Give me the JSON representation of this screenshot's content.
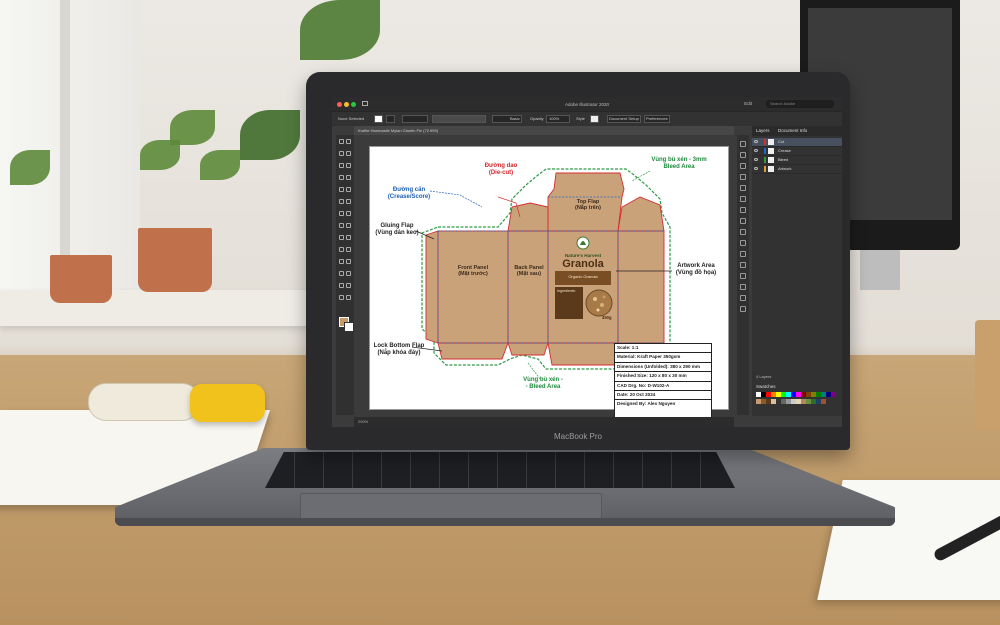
{
  "device": {
    "brand_label": "MacBook Pro"
  },
  "app": {
    "title": "Adobe Illustrator 2020",
    "menu_right": "Edit",
    "search_placeholder": "Search Adobe"
  },
  "control_bar": {
    "selection_label": "None Selected",
    "stroke_style": "Basic",
    "opacity_label": "Opacity",
    "opacity_value": "100%",
    "style_label": "Style",
    "doc_setup_label": "Document Setup",
    "preferences_label": "Preferences"
  },
  "document": {
    "tab_label": "Kraftie Hardcastle Mylan Glantin Ftv (72.959)",
    "zoom": "200%"
  },
  "layers_panel": {
    "tabs": [
      "Layers",
      "Document Info"
    ],
    "layers": [
      {
        "name": "Cut",
        "color": "#d32f2f"
      },
      {
        "name": "Crease",
        "color": "#1f68c9"
      },
      {
        "name": "Bleed",
        "color": "#2e9a47"
      },
      {
        "name": "Artwork",
        "color": "#d7a03b"
      }
    ],
    "layer_count_label": "4 Layers",
    "swatches_title": "Swatches"
  },
  "swatches": [
    "#ffffff",
    "#000000",
    "#ff0000",
    "#ff7f00",
    "#ffff00",
    "#00ff00",
    "#00ffff",
    "#0000ff",
    "#ff00ff",
    "#7f0000",
    "#7f3f00",
    "#7f7f00",
    "#007f00",
    "#007f7f",
    "#00007f",
    "#7f007f",
    "#c69a6d",
    "#8b5a2b",
    "#5a3a1a",
    "#d8c0a0",
    "#333333",
    "#666666",
    "#999999",
    "#cccccc",
    "#e6d6b8",
    "#b08a5b",
    "#6b8f3a",
    "#2e6b2e",
    "#1f3f6b",
    "#a0522d"
  ],
  "artboard": {
    "labels": {
      "die_cut": "Đường dao\n(Die-cut)",
      "crease": "Đường cấn\n(Crease/Score)",
      "bleed_top": "Vùng bù xén - 3mm\nBleed Area",
      "gluing_flap": "Gluing Flap\n(Vùng dán keo)",
      "artwork_area": "Artwork Area\n(Vùng đồ họa)",
      "lock_bottom": "Lock Bottom Flap\n(Nắp khóa đáy)",
      "bleed_bottom": "Vùng bù xén -\n- Bleed Area"
    },
    "panels": {
      "top_flap": "Top Flap\n(Nắp trên)",
      "front": "Front Panel\n(Mặt trước)",
      "back": "Back Panel\n(Mặt sau)"
    },
    "product": {
      "brand": "Nature's Harvest",
      "name": "Granola",
      "subtitle": "Organic Granola",
      "ingredients_title": "Ingredients:",
      "weight": "450g"
    },
    "title_block": [
      "Scale: 1:1",
      "Material: Kraft Paper 350gsm",
      "Dimensions (Unfolded): 380 x 290 mm",
      "Finished Size: 120 x 80 x 30 mm",
      "CAD Drg. No: D-W102-A",
      "Date: 20 Oct 2024",
      "Designed By: Alex Nguyen"
    ]
  }
}
